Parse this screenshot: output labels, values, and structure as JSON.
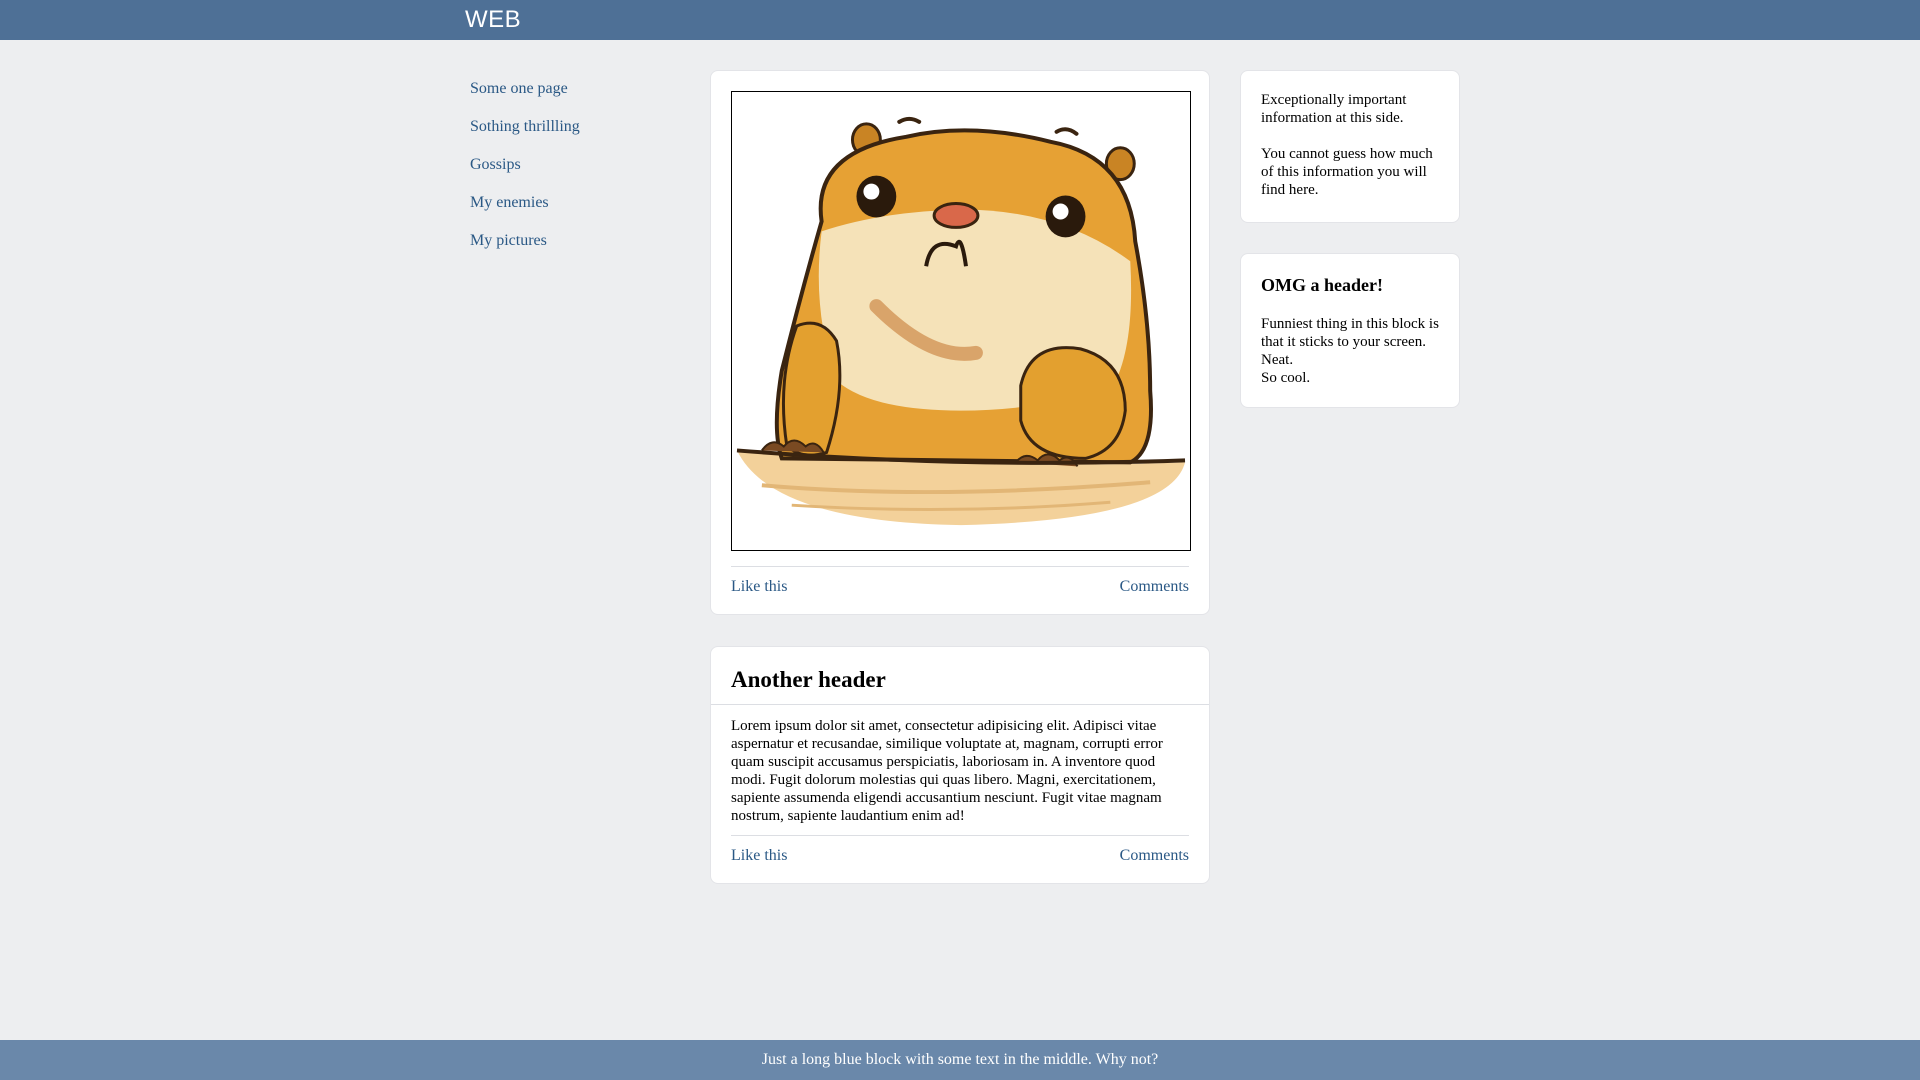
{
  "header": {
    "logo": "WEB"
  },
  "nav": {
    "items": [
      {
        "label": "Some one page"
      },
      {
        "label": "Sothing thrillling"
      },
      {
        "label": "Gossips"
      },
      {
        "label": "My enemies"
      },
      {
        "label": "My pictures"
      }
    ]
  },
  "posts": [
    {
      "like_label": "Like this",
      "comments_label": "Comments"
    },
    {
      "title": "Another header",
      "body": "Lorem ipsum dolor sit amet, consectetur adipisicing elit. Adipisci vitae aspernatur et recusandae, similique voluptate at, magnam, corrupti error quam suscipit accusamus perspiciatis, laboriosam in. A inventore quod modi. Fugit dolorum molestias qui quas libero. Magni, exercitationem, sapiente assumenda eligendi accusantium nesciunt. Fugit vitae magnam nostrum, sapiente laudantium enim ad!",
      "like_label": "Like this",
      "comments_label": "Comments"
    }
  ],
  "sidebar": {
    "info": {
      "line1": "Exceptionally important information at this side.",
      "line2": "You cannot guess how much of this information you will find here."
    },
    "sticky": {
      "title": "OMG a header!",
      "line1": "Funniest thing in this block is that it sticks to your screen. Neat.",
      "line2": "So cool."
    }
  },
  "footer": {
    "text": "Just a long blue block with some text in the middle. Why not?"
  },
  "colors": {
    "header_bg": "#4e7096",
    "footer_bg": "#6a88aa",
    "page_bg": "#edeef0",
    "link": "#2a5885"
  }
}
